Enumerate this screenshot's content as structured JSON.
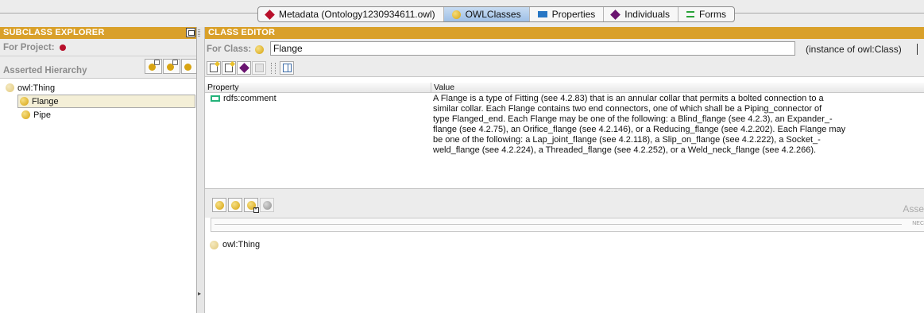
{
  "tabs": [
    {
      "label": "Metadata (Ontology1230934611.owl)",
      "icon": "metadata-diamond-icon",
      "active": false
    },
    {
      "label": "OWLClasses",
      "icon": "class-ball-icon",
      "active": true
    },
    {
      "label": "Properties",
      "icon": "properties-rect-icon",
      "active": false
    },
    {
      "label": "Individuals",
      "icon": "individuals-diamond-icon",
      "active": false
    },
    {
      "label": "Forms",
      "icon": "forms-icon",
      "active": false
    }
  ],
  "subclass_explorer": {
    "title": "SUBCLASS EXPLORER",
    "for_project_label": "For Project:",
    "hierarchy_label": "Asserted Hierarchy",
    "tree": [
      {
        "label": "owl:Thing",
        "level": 0,
        "selected": false
      },
      {
        "label": "Flange",
        "level": 1,
        "selected": true
      },
      {
        "label": "Pipe",
        "level": 1,
        "selected": false
      }
    ]
  },
  "class_editor": {
    "title": "CLASS EDITOR",
    "for_class_label": "For Class:",
    "class_name": "Flange",
    "instance_of": "(instance of owl:Class)",
    "table": {
      "columns": [
        "Property",
        "Value"
      ],
      "rows": [
        {
          "property": "rdfs:comment",
          "value": "A Flange is a type of Fitting (see 4.2.83) that is an annular collar that permits a bolted connection to a\nsimilar collar. Each Flange contains two end connectors, one of which shall be a Piping_connector of\ntype Flanged_end. Each Flange may be one of the following: a Blind_flange (see 4.2.3), an Expander_-\nflange (see 4.2.75), an Orifice_flange (see 4.2.146), or a Reducing_flange (see 4.2.202). Each Flange may\nbe one of the following: a Lap_joint_flange (see 4.2.118), a Slip_on_flange (see 4.2.222), a Socket_-\nweld_flange (see 4.2.224), a Threaded_flange (see 4.2.252), or a Weld_neck_flange (see 4.2.266)."
        }
      ]
    },
    "asserted_label": "Asse",
    "necessary_label": "NEC",
    "superclass": "owl:Thing"
  }
}
